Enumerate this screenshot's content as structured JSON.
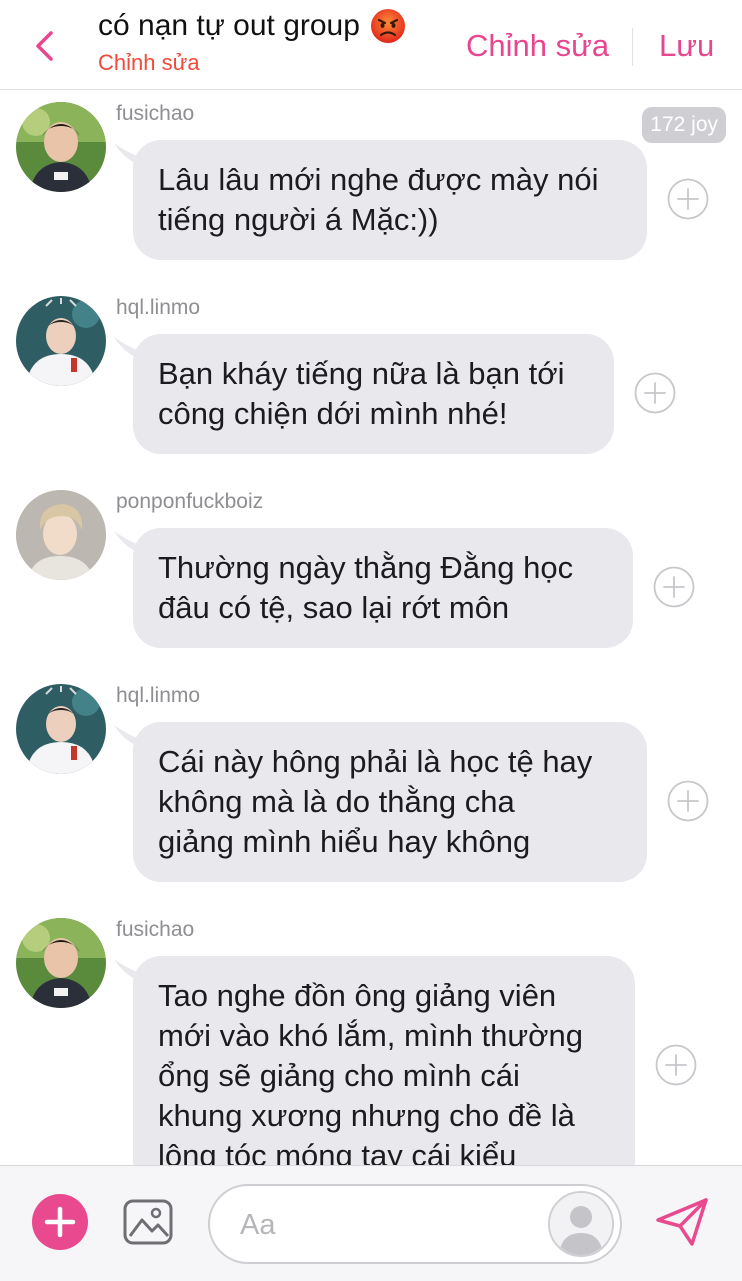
{
  "header": {
    "title": "có nạn tự out group",
    "title_emoji": "angry-face-emoji",
    "subtitle": "Chỉnh sửa",
    "edit_label": "Chỉnh sửa",
    "save_label": "Lưu",
    "accent_color": "#e8478f",
    "subtitle_color": "#f04a3a"
  },
  "messages": [
    {
      "username": "fusichao",
      "lines": [
        "Lâu lâu mới nghe được mày nói",
        "tiếng người á Mặc:))"
      ],
      "badge": "172 joy"
    },
    {
      "username": "hql.linmo",
      "lines": [
        "Bạn kháy tiếng nữa là bạn tới",
        "công chiện dới mình nhé!"
      ]
    },
    {
      "username": "ponponfuckboiz",
      "lines": [
        "Thường ngày thằng Đằng học",
        "đâu có tệ, sao lại rớt môn"
      ]
    },
    {
      "username": "hql.linmo",
      "lines": [
        "Cái này hông phải là học tệ hay",
        "không mà là do thằng cha",
        "giảng mình hiểu hay không"
      ]
    },
    {
      "username": "fusichao",
      "lines": [
        "Tao nghe đồn ông giảng viên",
        "mới vào khó lắm, mình thường",
        "ổng sẽ giảng cho mình cái",
        "khung xương nhưng cho đề là",
        "lông tóc móng tay cái kiểu"
      ]
    }
  ],
  "composer": {
    "placeholder": "Aa"
  },
  "colors": {
    "accent": "#e94a8f",
    "bubble": "#e9e9ed",
    "username": "#8e8e93"
  }
}
